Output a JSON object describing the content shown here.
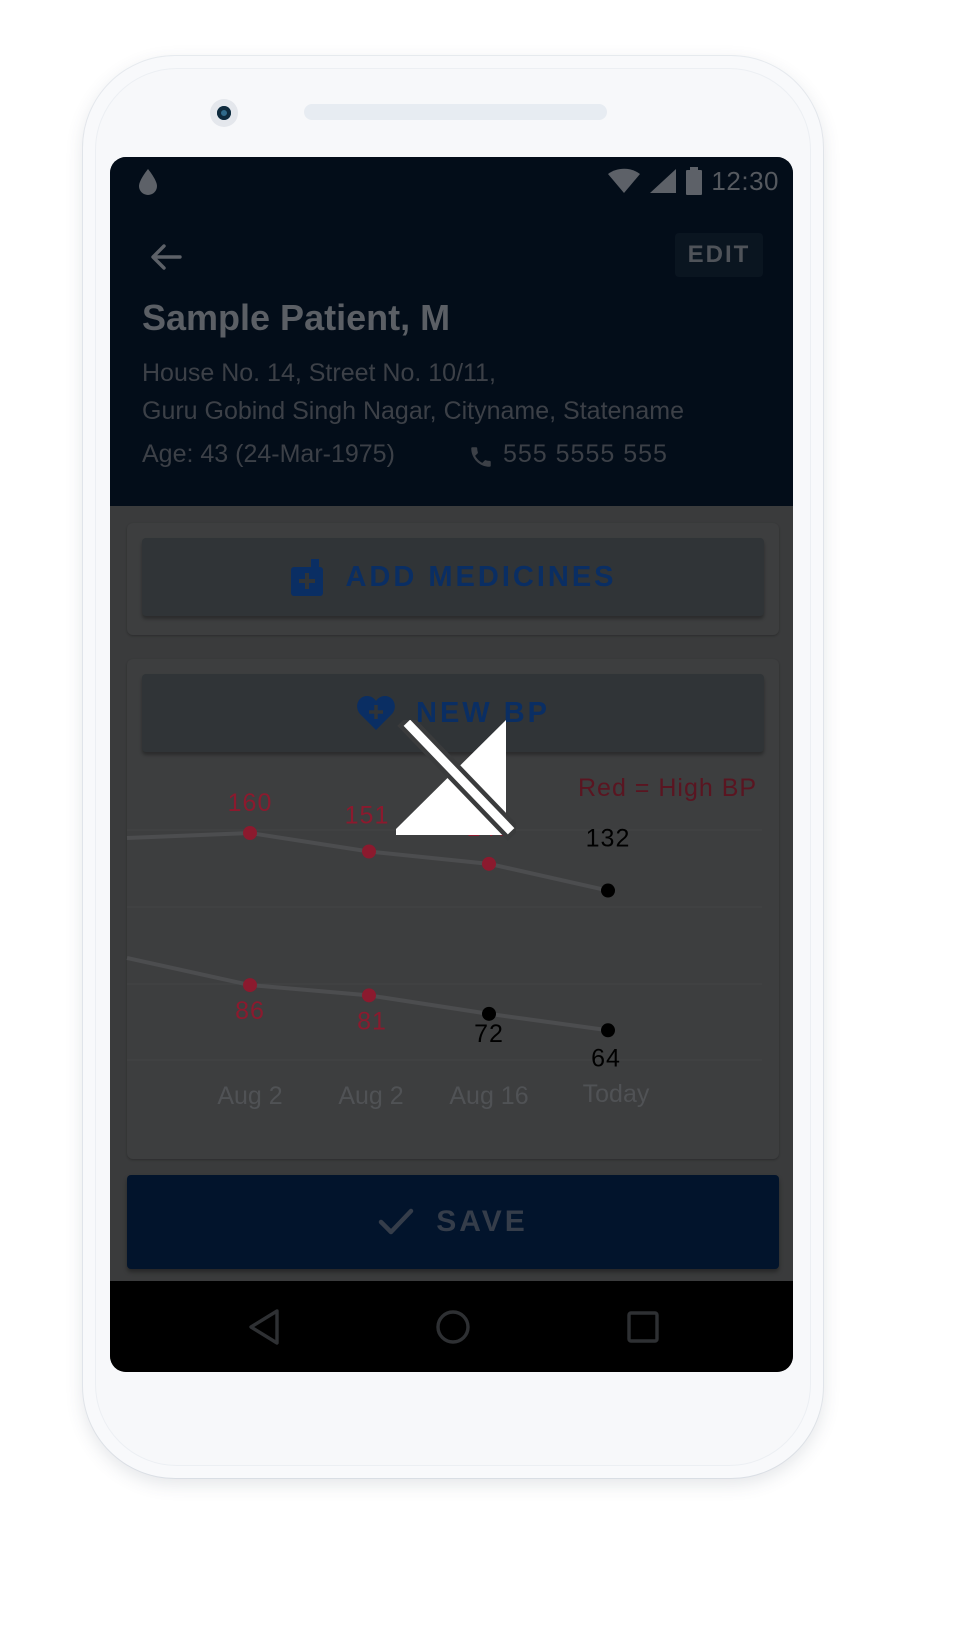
{
  "status_bar": {
    "time": "12:30",
    "icons": [
      "drop-icon",
      "wifi-icon",
      "signal-icon",
      "battery-icon"
    ]
  },
  "header": {
    "back_icon": "arrow-left-icon",
    "edit_label": "EDIT",
    "patient_name": "Sample Patient, M",
    "address_line1": "House No. 14, Street No. 10/11,",
    "address_line2": "Guru Gobind Singh Nagar, Cityname, Statename",
    "age": "Age: 43 (24-Mar-1975)",
    "phone_icon": "phone-icon",
    "phone_number": "555 5555 555"
  },
  "medicines_card": {
    "button_label": "ADD MEDICINES",
    "icon": "medicine-bottle-icon"
  },
  "bp_card": {
    "button_label": "NEW BP",
    "icon": "heart-plus-icon",
    "legend": "Red = High BP"
  },
  "chart_data": {
    "type": "line",
    "x": [
      "Aug 2",
      "Aug 2",
      "Aug 16",
      "Today"
    ],
    "series": [
      {
        "values": [
          160,
          151,
          145,
          132
        ],
        "high": [
          true,
          true,
          true,
          false
        ]
      },
      {
        "values": [
          86,
          81,
          72,
          64
        ],
        "high": [
          true,
          true,
          false,
          false
        ]
      }
    ],
    "high_color": "#8b1a2e",
    "normal_color": "#000000",
    "grid": true
  },
  "save_button": {
    "label": "SAVE",
    "icon": "check-icon"
  },
  "nav_bar": {
    "icons": [
      "back-triangle-icon",
      "home-circle-icon",
      "recents-square-icon"
    ]
  },
  "overlay": {
    "icon": "volume-mute-icon"
  },
  "colors": {
    "header_bg": "#030d19",
    "screen_bg": "#3a3b3c",
    "accent_blue": "#0a2e63",
    "high_bp_red": "#8b1a2e",
    "save_bg": "#02142c"
  }
}
